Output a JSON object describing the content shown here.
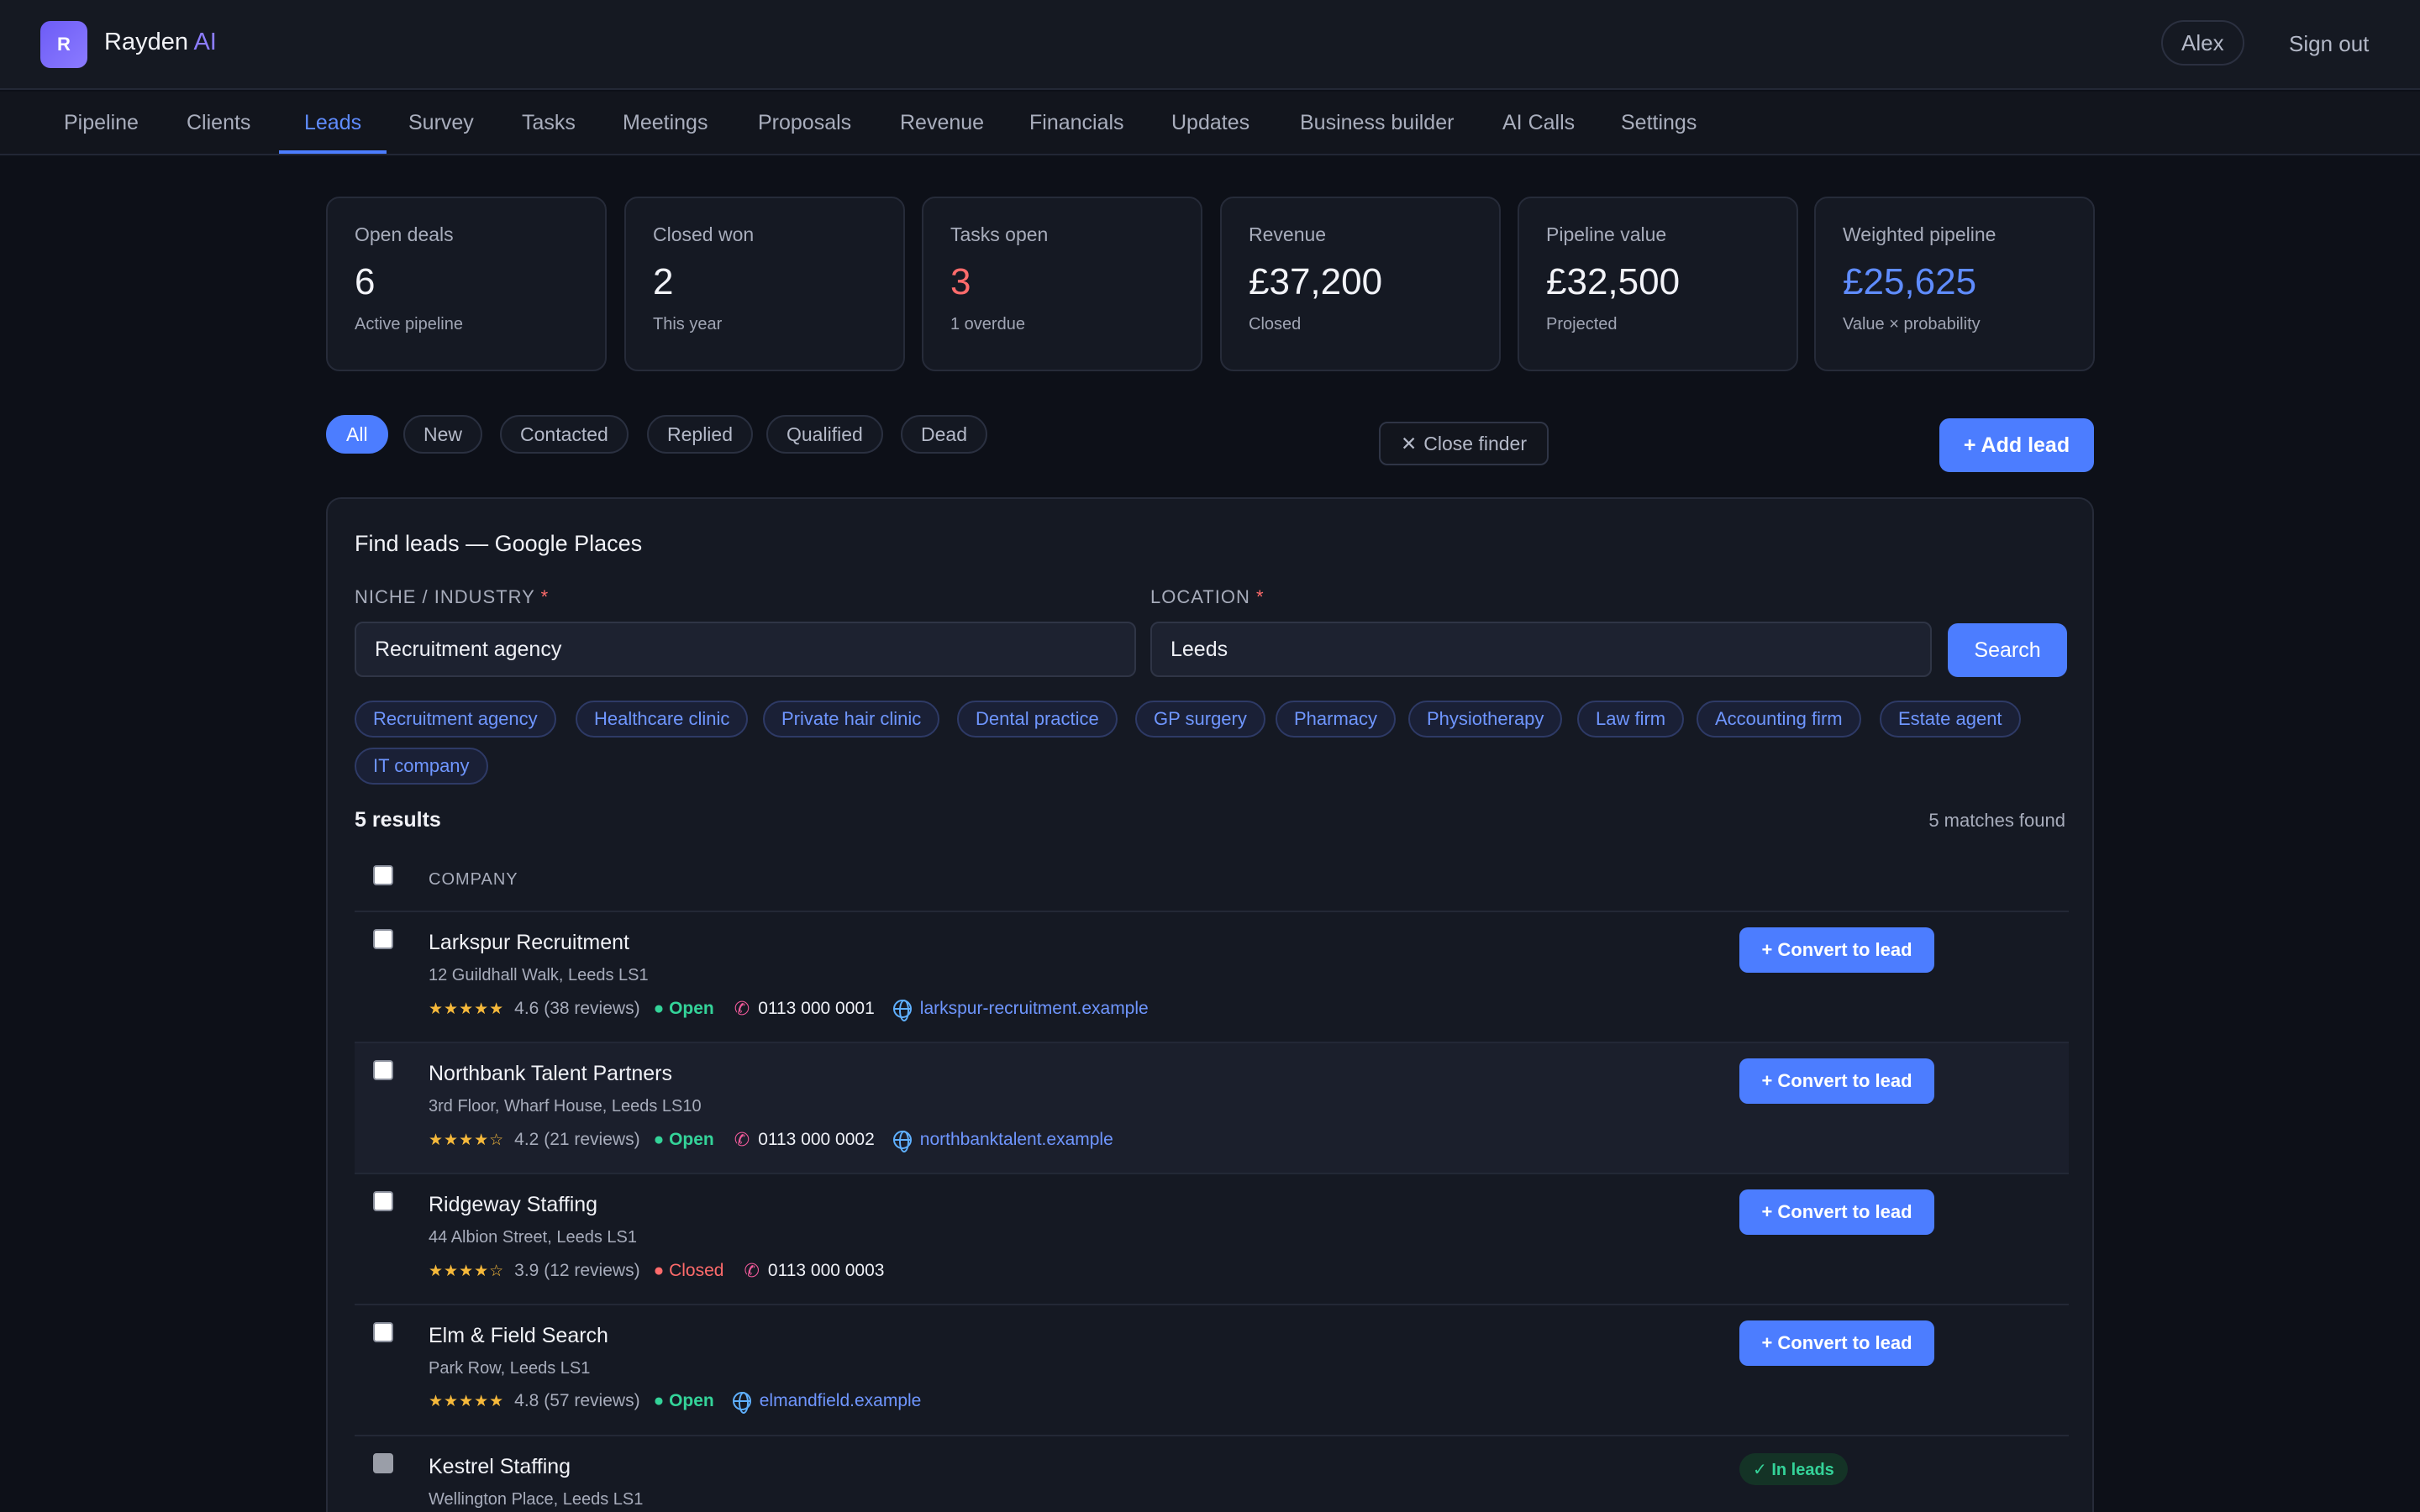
{
  "app": {
    "logo_letter": "R",
    "name": "Rayden",
    "name_suffix": "AI"
  },
  "user": {
    "name": "Alex",
    "sign_out": "Sign out"
  },
  "nav": [
    "Pipeline",
    "Clients",
    "Leads",
    "Survey",
    "Tasks",
    "Meetings",
    "Proposals",
    "Revenue",
    "Financials",
    "Updates",
    "Business builder",
    "AI Calls",
    "Settings"
  ],
  "nav_active": "Leads",
  "stats": [
    {
      "label": "Open deals",
      "value": "6",
      "sub": "Active pipeline"
    },
    {
      "label": "Closed won",
      "value": "2",
      "sub": "This year"
    },
    {
      "label": "Tasks open",
      "value": "3",
      "sub": "1 overdue"
    },
    {
      "label": "Revenue",
      "value": "£37,200",
      "sub": "Closed"
    },
    {
      "label": "Pipeline value",
      "value": "£32,500",
      "sub": "Projected"
    },
    {
      "label": "Weighted pipeline",
      "value": "£25,625",
      "sub": "Value × probability"
    }
  ],
  "filters": [
    "All",
    "New",
    "Contacted",
    "Replied",
    "Qualified",
    "Dead"
  ],
  "filter_active": "All",
  "close_finder": "Close finder",
  "add_lead": "+ Add lead",
  "finder": {
    "title": "Find leads — Google Places",
    "niche_label": "NICHE / INDUSTRY",
    "niche_value": "Recruitment agency",
    "location_label": "LOCATION",
    "location_value": "Leeds",
    "required_mark": "*",
    "search": "Search",
    "suggestions": [
      "Recruitment agency",
      "Healthcare clinic",
      "Private hair clinic",
      "Dental practice",
      "GP surgery",
      "Pharmacy",
      "Physiotherapy",
      "Law firm",
      "Accounting firm",
      "Estate agent",
      "IT company"
    ],
    "results_title": "5 results",
    "matches_found": "5 matches found",
    "column_company": "COMPANY",
    "convert_label": "+ Convert to lead",
    "in_leads_label": "✓ In leads"
  },
  "results": [
    {
      "name": "Larkspur Recruitment",
      "address": "12 Guildhall Walk, Leeds LS1",
      "stars": "★★★★★",
      "rating": "4.6 (38 reviews)",
      "status": "● Open",
      "phone": "0113 000 0001",
      "website": "larkspur-recruitment.example"
    },
    {
      "name": "Northbank Talent Partners",
      "address": "3rd Floor, Wharf House, Leeds LS10",
      "stars": "★★★★☆",
      "rating": "4.2 (21 reviews)",
      "status": "● Open",
      "phone": "0113 000 0002",
      "website": "northbanktalent.example"
    },
    {
      "name": "Ridgeway Staffing",
      "address": "44 Albion Street, Leeds LS1",
      "stars": "★★★★☆",
      "rating": "3.9 (12 reviews)",
      "status": "● Closed",
      "phone": "0113 000 0003"
    },
    {
      "name": "Elm & Field Search",
      "address": "Park Row, Leeds LS1",
      "stars": "★★★★★",
      "rating": "4.8 (57 reviews)",
      "status": "● Open",
      "website": "elmandfield.example"
    },
    {
      "name": "Kestrel Staffing",
      "address": "Wellington Place, Leeds LS1"
    }
  ],
  "colors": {
    "accent": "#4c7dff",
    "brand": "#6d5cf6",
    "danger": "#ff6b6b",
    "success": "#34d399",
    "star": "#f6b93b"
  }
}
